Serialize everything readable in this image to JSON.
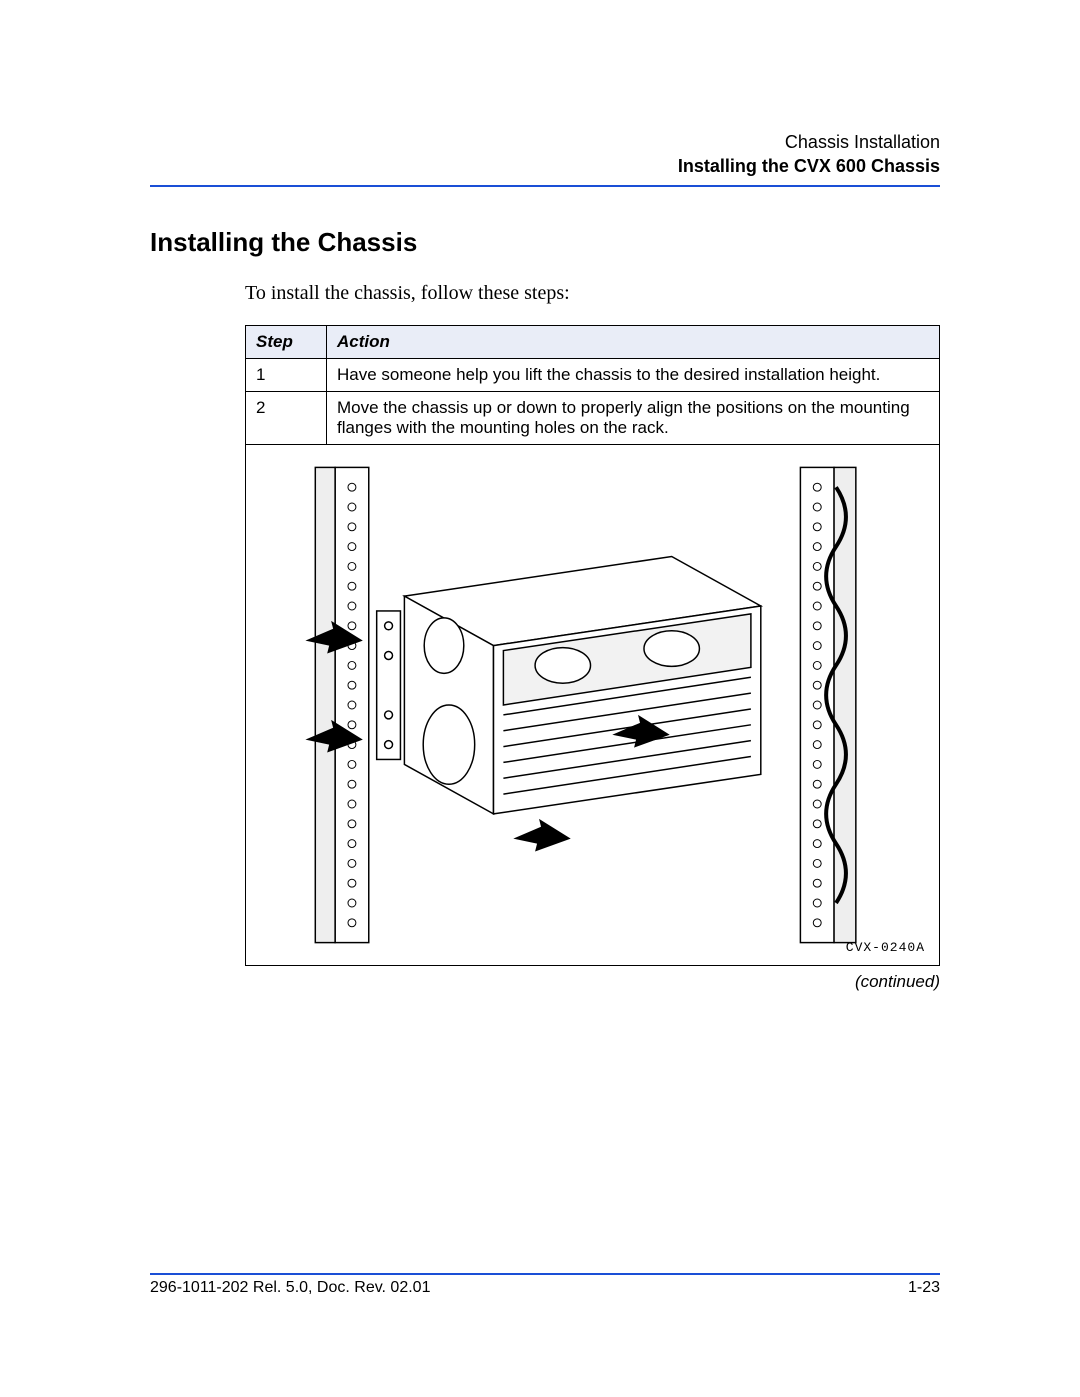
{
  "header": {
    "chapter": "Chassis Installation",
    "section": "Installing the CVX 600 Chassis"
  },
  "title": "Installing the Chassis",
  "intro": "To install the chassis, follow these steps:",
  "columns": {
    "step": "Step",
    "action": "Action"
  },
  "rows": [
    {
      "step": "1",
      "action": "Have someone help you lift the chassis to the desired installation height."
    },
    {
      "step": "2",
      "action": "Move the chassis up or down to properly align the positions on the mounting flanges with the mounting holes on the rack."
    }
  ],
  "figure_label": "CVX-0240A",
  "continued": "(continued)",
  "footer": {
    "doc": "296-1011-202 Rel. 5.0, Doc. Rev. 02.01",
    "page": "1-23"
  }
}
